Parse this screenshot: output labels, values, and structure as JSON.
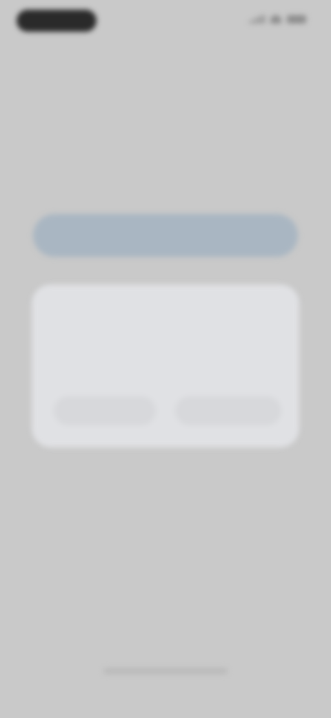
{
  "status_bar": {
    "time": "",
    "icons": [
      "signal-icon",
      "wifi-icon",
      "battery-icon"
    ]
  },
  "page": {
    "title": "",
    "subtitle": "",
    "primary_button_label": ""
  },
  "dialog": {
    "title": "",
    "body": "",
    "cancel_label": "",
    "confirm_label": ""
  },
  "colors": {
    "background": "#c9c9c9",
    "dialog": "#e0e1e4",
    "primary_bar": "#a9b6c2",
    "status_pill": "#2a2a2a"
  }
}
